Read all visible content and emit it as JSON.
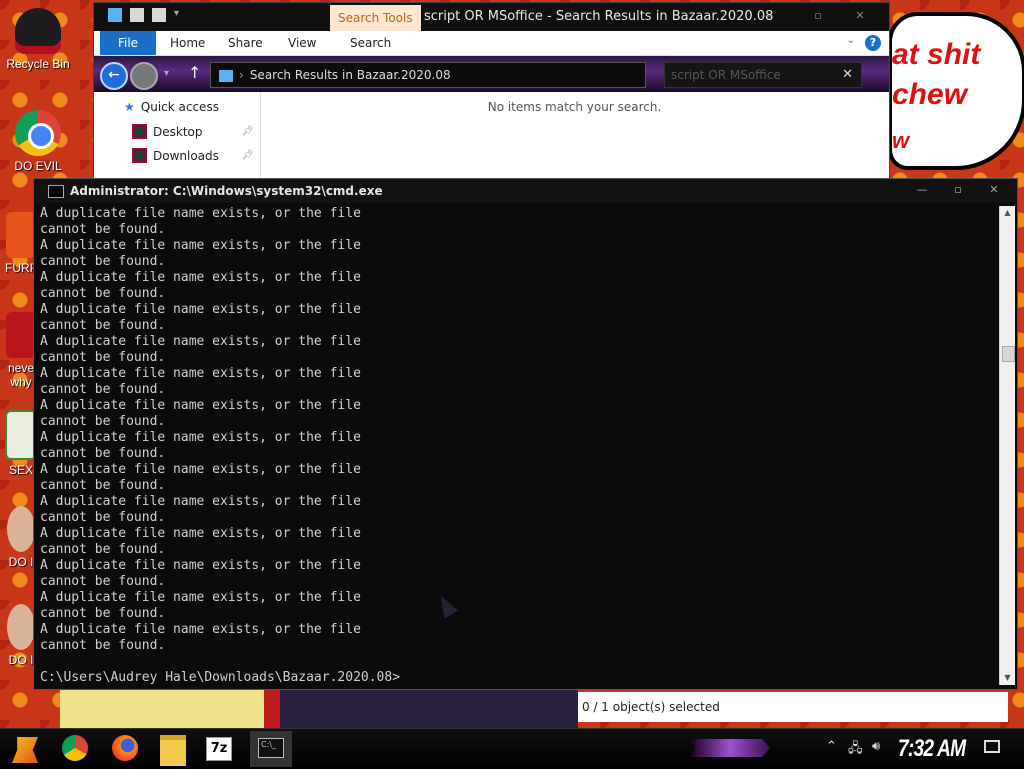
{
  "desktop": {
    "icons": [
      {
        "label": "Recycle Bin",
        "icon": "recycle-bin-icon"
      },
      {
        "label": "DO EVIL",
        "icon": "chrome-icon"
      },
      {
        "label": "FURF",
        "icon": "app-icon"
      },
      {
        "label": "neve why",
        "icon": "document-icon"
      },
      {
        "label": "SEX",
        "icon": "document-icon"
      },
      {
        "label": "DO I",
        "icon": "image-icon"
      },
      {
        "label": "DO I",
        "icon": "image-icon"
      }
    ],
    "comic_text": [
      "at shit",
      "chew",
      "w"
    ]
  },
  "explorer": {
    "context_tab": "Search Tools",
    "title": "script OR MSoffice - Search Results in Bazaar.2020.08",
    "ribbon_tabs": [
      "File",
      "Home",
      "Share",
      "View",
      "Search"
    ],
    "help_label": "?",
    "address_path": "Search Results in Bazaar.2020.08",
    "search_value": "script OR MSoffice",
    "nav_items": [
      {
        "label": "Quick access",
        "icon": "star-icon"
      },
      {
        "label": "Desktop",
        "icon": "desktop-icon"
      },
      {
        "label": "Downloads",
        "icon": "downloads-icon"
      }
    ],
    "empty_message": "No items match your search.",
    "status": "0 / 1 object(s) selected"
  },
  "cmd": {
    "title": "Administrator: C:\\Windows\\system32\\cmd.exe",
    "lines": [
      "A duplicate file name exists, or the file",
      "cannot be found.",
      "A duplicate file name exists, or the file",
      "cannot be found.",
      "A duplicate file name exists, or the file",
      "cannot be found.",
      "A duplicate file name exists, or the file",
      "cannot be found.",
      "A duplicate file name exists, or the file",
      "cannot be found.",
      "A duplicate file name exists, or the file",
      "cannot be found.",
      "A duplicate file name exists, or the file",
      "cannot be found.",
      "A duplicate file name exists, or the file",
      "cannot be found.",
      "A duplicate file name exists, or the file",
      "cannot be found.",
      "A duplicate file name exists, or the file",
      "cannot be found.",
      "A duplicate file name exists, or the file",
      "cannot be found.",
      "A duplicate file name exists, or the file",
      "cannot be found.",
      "A duplicate file name exists, or the file",
      "cannot be found.",
      "A duplicate file name exists, or the file",
      "cannot be found.",
      "",
      "C:\\Users\\Audrey Hale\\Downloads\\Bazaar.2020.08>"
    ]
  },
  "taskbar": {
    "apps": [
      "start-icon",
      "chrome-icon",
      "firefox-icon",
      "file-explorer-icon",
      "7zip-icon",
      "cmd-icon"
    ],
    "label_7z": "7z",
    "cmd_glyph": "C:\\_",
    "clock": "7:32 AM"
  }
}
